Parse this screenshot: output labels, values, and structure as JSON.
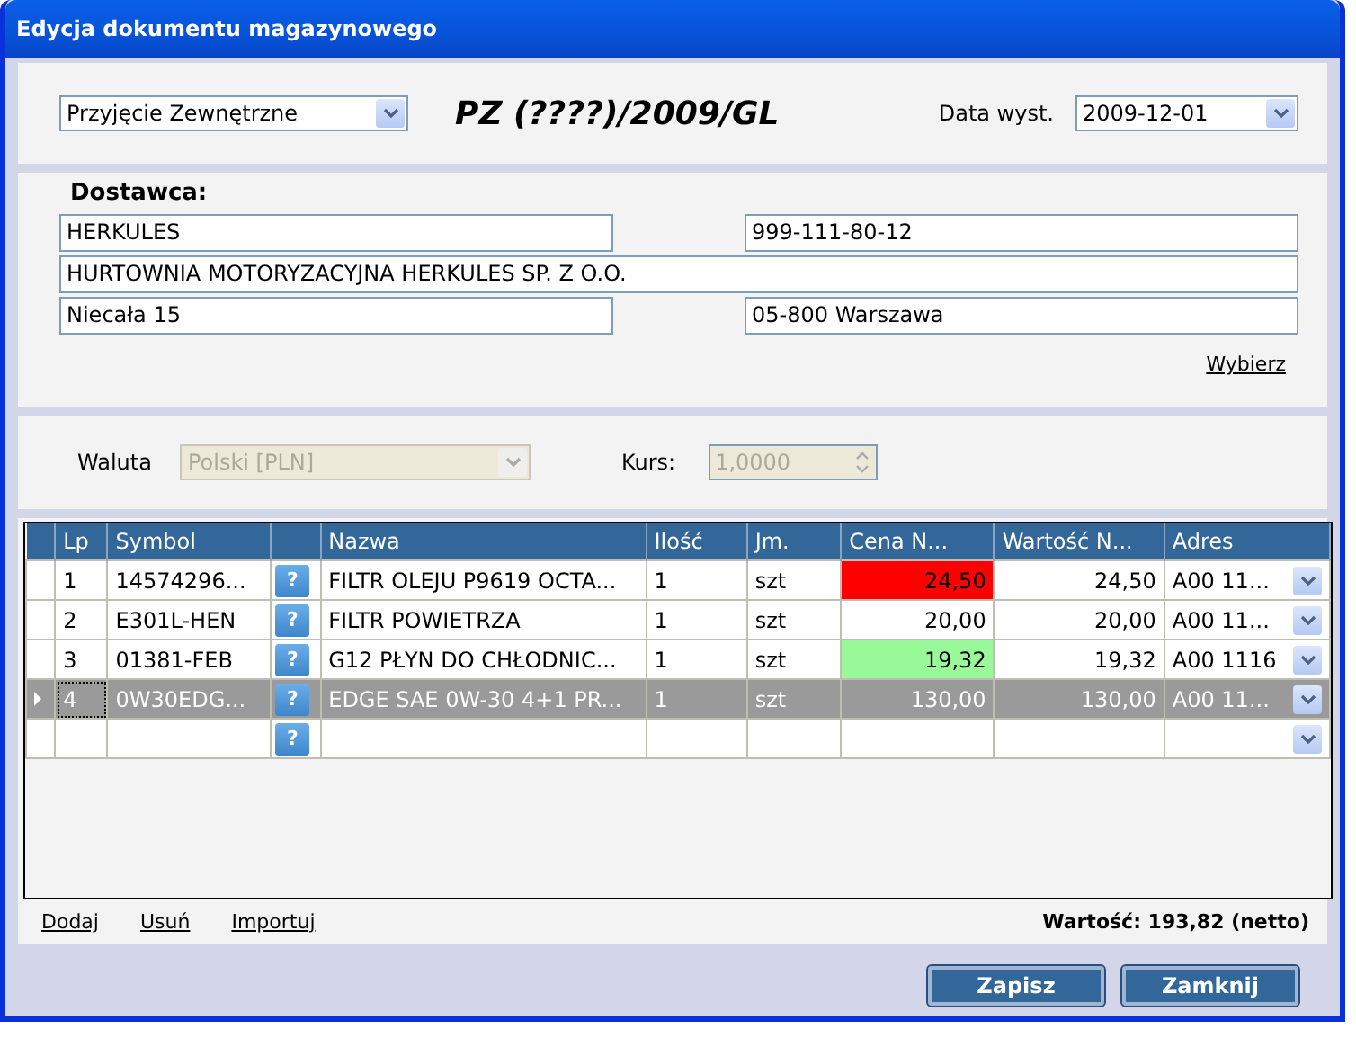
{
  "window": {
    "title": "Edycja dokumentu magazynowego"
  },
  "header": {
    "doc_type": "Przyjęcie Zewnętrzne",
    "doc_number": "PZ (????)/2009/GL",
    "date_label": "Data wyst.",
    "date": "2009-12-01"
  },
  "supplier": {
    "heading": "Dostawca:",
    "name": "HERKULES",
    "tax_id": "999-111-80-12",
    "full_name": "HURTOWNIA MOTORYZACYJNA HERKULES SP. Z O.O.",
    "street": "Niecała 15",
    "city": "05-800 Warszawa",
    "choose_link": "Wybierz"
  },
  "currency": {
    "label": "Waluta",
    "value": "Polski [PLN]",
    "disabled": true,
    "rate_label": "Kurs:",
    "rate": "1,0000"
  },
  "table": {
    "columns": [
      "Lp",
      "Symbol",
      "Nazwa",
      "Ilość",
      "Jm.",
      "Cena N...",
      "Wartość N...",
      "Adres"
    ],
    "rows": [
      {
        "kind": "item",
        "selected": false,
        "lp": "1",
        "symbol": "14574296...",
        "help": "?",
        "name": "FILTR OLEJU P9619 OCTA...",
        "qty": "1",
        "unit": "szt",
        "price": "24,50",
        "color": "#ff0000",
        "value": "24,50",
        "address": "A00 11..."
      },
      {
        "kind": "item",
        "selected": false,
        "lp": "2",
        "symbol": "E301L-HEN",
        "help": "?",
        "name": "FILTR POWIETRZA",
        "qty": "1",
        "unit": "szt",
        "price": "20,00",
        "value": "20,00",
        "address": "A00 11..."
      },
      {
        "kind": "item",
        "selected": false,
        "lp": "3",
        "symbol": "01381-FEB",
        "help": "?",
        "name": "G12 PŁYN DO CHŁODNIC...",
        "qty": "1",
        "unit": "szt",
        "price": "19,32",
        "color": "#99f999",
        "value": "19,32",
        "address": "A00 1116"
      },
      {
        "kind": "item",
        "selected": true,
        "lp": "4",
        "symbol": "0W30EDG...",
        "help": "?",
        "name": "EDGE SAE 0W-30 4+1 PR...",
        "qty": "1",
        "unit": "szt",
        "price": "130,00",
        "value": "130,00",
        "address": "A00 11..."
      },
      {
        "kind": "blank",
        "selected": false,
        "help": "?"
      }
    ]
  },
  "footer": {
    "links": [
      "Dodaj",
      "Usuń",
      "Importuj"
    ],
    "total": "Wartość: 193,82 (netto)"
  },
  "buttons": [
    "Zapisz",
    "Zamknij"
  ]
}
